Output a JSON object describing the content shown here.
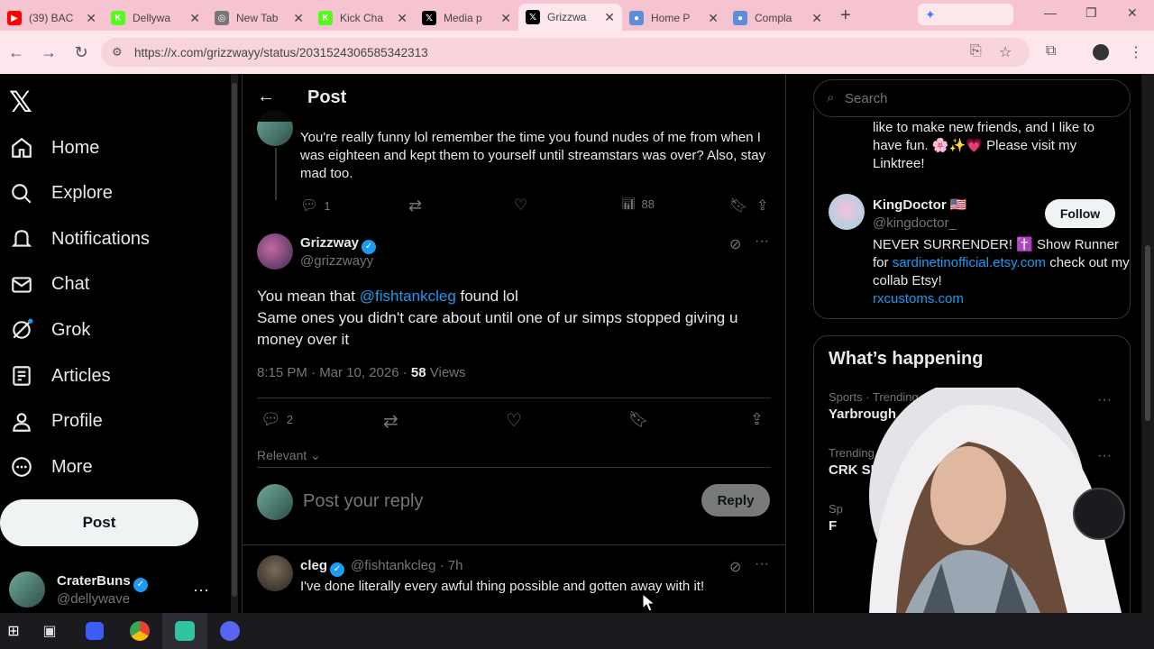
{
  "browser": {
    "tabs": [
      {
        "title": "(39) BAC",
        "color": "#ff0000",
        "glyph": "▶"
      },
      {
        "title": "Dellywa",
        "color": "#53fc18",
        "glyph": "K"
      },
      {
        "title": "New Tab",
        "color": "#777777",
        "glyph": "◎"
      },
      {
        "title": "Kick Cha",
        "color": "#53fc18",
        "glyph": "K"
      },
      {
        "title": "Media p",
        "color": "#000000",
        "glyph": "𝕏"
      },
      {
        "title": "Grizzwa",
        "color": "#000000",
        "glyph": "𝕏"
      },
      {
        "title": "Home P",
        "color": "#5b8dd8",
        "glyph": "●"
      },
      {
        "title": "Compla",
        "color": "#5b8dd8",
        "glyph": "●"
      }
    ],
    "url": "https://x.com/grizzwayy/status/2031524306585342313"
  },
  "nav": {
    "items": [
      {
        "label": "Home",
        "icon": "home-icon"
      },
      {
        "label": "Explore",
        "icon": "search-icon"
      },
      {
        "label": "Notifications",
        "icon": "bell-icon"
      },
      {
        "label": "Chat",
        "icon": "mail-icon"
      },
      {
        "label": "Grok",
        "icon": "grok-icon"
      },
      {
        "label": "Articles",
        "icon": "article-icon"
      },
      {
        "label": "Profile",
        "icon": "person-icon"
      },
      {
        "label": "More",
        "icon": "more-circle-icon"
      }
    ],
    "post_label": "Post",
    "account": {
      "name": "CraterBuns",
      "handle": "@dellywave"
    }
  },
  "header": {
    "title": "Post"
  },
  "parent_tweet": {
    "text": "You're really funny lol remember the time you found nudes of me from when I was eighteen and kept them to yourself until streamstars was over? Also, stay mad too.",
    "replies": "1",
    "views": "88"
  },
  "main_tweet": {
    "name": "Grizzway",
    "handle": "@grizzwayy",
    "text_before": "You mean that ",
    "mention": "@fishtankcleg",
    "text_after": " found lol",
    "line2": "Same ones you didn't care about until one of ur simps stopped giving u money over it",
    "time": "8:15 PM · Mar 10, 2026 · ",
    "views_count": "58",
    "views_label": " Views",
    "replies": "2"
  },
  "sort": {
    "label": "Relevant"
  },
  "composer": {
    "placeholder": "Post your reply",
    "button": "Reply"
  },
  "reply_tweet": {
    "name": "cleg",
    "meta": "@fishtankcleg · 7h",
    "text": "I've done literally every awful thing possible and gotten away with it!"
  },
  "sidebar": {
    "search_placeholder": "Search",
    "bio_continued": "like to make new friends, and I like to have fun. 🌸✨💗 Please visit my Linktree!",
    "suggest": {
      "name": "KingDoctor 🇺🇸",
      "handle": "@kingdoctor_",
      "follow": "Follow",
      "bio1": "NEVER SURRENDER! ✝️ Show Runner for ",
      "link1": "sardinetinofficial.etsy.com",
      "bio2": " check out my collab Etsy!",
      "link2": "rxcustoms.com"
    },
    "happening": {
      "title": "What’s happening",
      "trends": [
        {
          "meta": "Sports · Trending",
          "name": "Yarbrough"
        },
        {
          "meta": "Trending in U",
          "name": "CRK SPO"
        },
        {
          "meta": "Sp",
          "name": "F"
        }
      ]
    }
  },
  "colors": {
    "accent": "#1d9bf0",
    "tabbar": "#f6c4d0",
    "addrbar": "#fde7ec"
  }
}
